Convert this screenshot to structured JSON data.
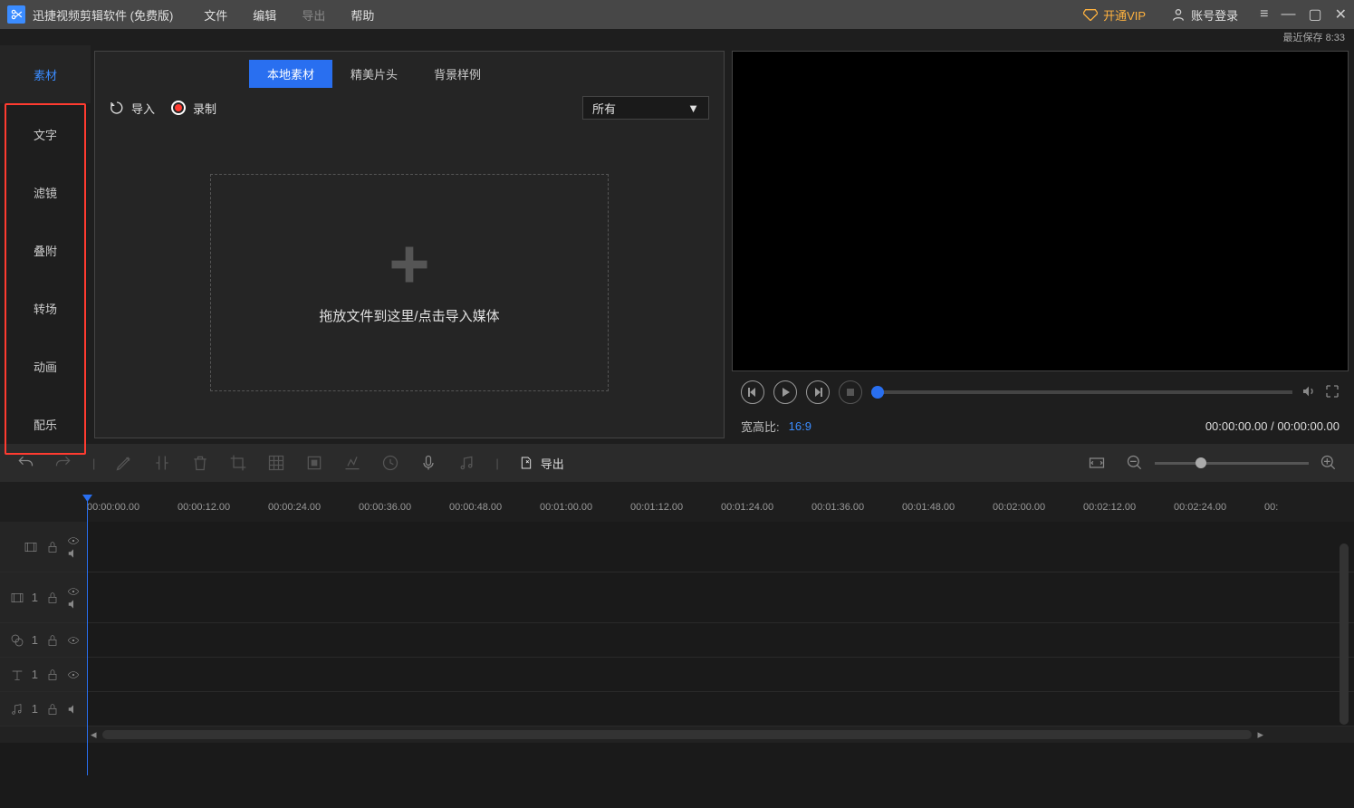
{
  "titlebar": {
    "app_title": "迅捷视频剪辑软件 (免费版)",
    "menus": [
      "文件",
      "编辑",
      "导出",
      "帮助"
    ],
    "vip_label": "开通VIP",
    "login_label": "账号登录"
  },
  "status": {
    "last_save": "最近保存 8:33"
  },
  "sidebar": {
    "items": [
      {
        "label": "素材",
        "active": true
      },
      {
        "label": "文字"
      },
      {
        "label": "滤镜"
      },
      {
        "label": "叠附"
      },
      {
        "label": "转场"
      },
      {
        "label": "动画"
      },
      {
        "label": "配乐"
      }
    ]
  },
  "media_panel": {
    "tabs": [
      {
        "label": "本地素材",
        "active": true
      },
      {
        "label": "精美片头"
      },
      {
        "label": "背景样例"
      }
    ],
    "import_label": "导入",
    "record_label": "录制",
    "filter_selected": "所有",
    "dropzone_text": "拖放文件到这里/点击导入媒体"
  },
  "preview": {
    "aspect_label": "宽高比:",
    "aspect_value": "16:9",
    "time_display": "00:00:00.00 / 00:00:00.00"
  },
  "toolbar": {
    "export_label": "导出"
  },
  "timeline": {
    "ticks": [
      "00:00:00.00",
      "00:00:12.00",
      "00:00:24.00",
      "00:00:36.00",
      "00:00:48.00",
      "00:01:00.00",
      "00:01:12.00",
      "00:01:24.00",
      "00:01:36.00",
      "00:01:48.00",
      "00:02:00.00",
      "00:02:12.00",
      "00:02:24.00",
      "00:"
    ],
    "tracks": [
      {
        "type": "video-main",
        "index": "",
        "small": false
      },
      {
        "type": "video",
        "index": "1",
        "small": false
      },
      {
        "type": "overlay",
        "index": "1",
        "small": true
      },
      {
        "type": "text",
        "index": "1",
        "small": true
      },
      {
        "type": "audio",
        "index": "1",
        "small": true
      }
    ]
  }
}
